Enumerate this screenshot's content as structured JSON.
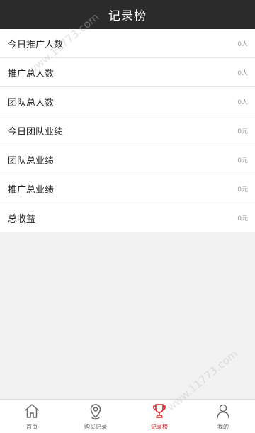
{
  "header": {
    "title": "记录榜"
  },
  "stats": [
    {
      "label": "今日推广人数",
      "value": "0人"
    },
    {
      "label": "推广总人数",
      "value": "0人"
    },
    {
      "label": "团队总人数",
      "value": "0人"
    },
    {
      "label": "今日团队业绩",
      "value": "0元"
    },
    {
      "label": "团队总业绩",
      "value": "0元"
    },
    {
      "label": "推广总业绩",
      "value": "0元"
    },
    {
      "label": "总收益",
      "value": "0元"
    }
  ],
  "tabbar": {
    "items": [
      {
        "label": "首页",
        "icon": "home-icon"
      },
      {
        "label": "购买记录",
        "icon": "location-pin-icon"
      },
      {
        "label": "记录榜",
        "icon": "trophy-icon",
        "active": true
      },
      {
        "label": "我的",
        "icon": "user-icon"
      }
    ]
  },
  "watermark": {
    "text": "www.11773.com"
  },
  "colors": {
    "header_bg": "#2b2b2b",
    "active": "#d9262b",
    "inactive": "#666666"
  }
}
